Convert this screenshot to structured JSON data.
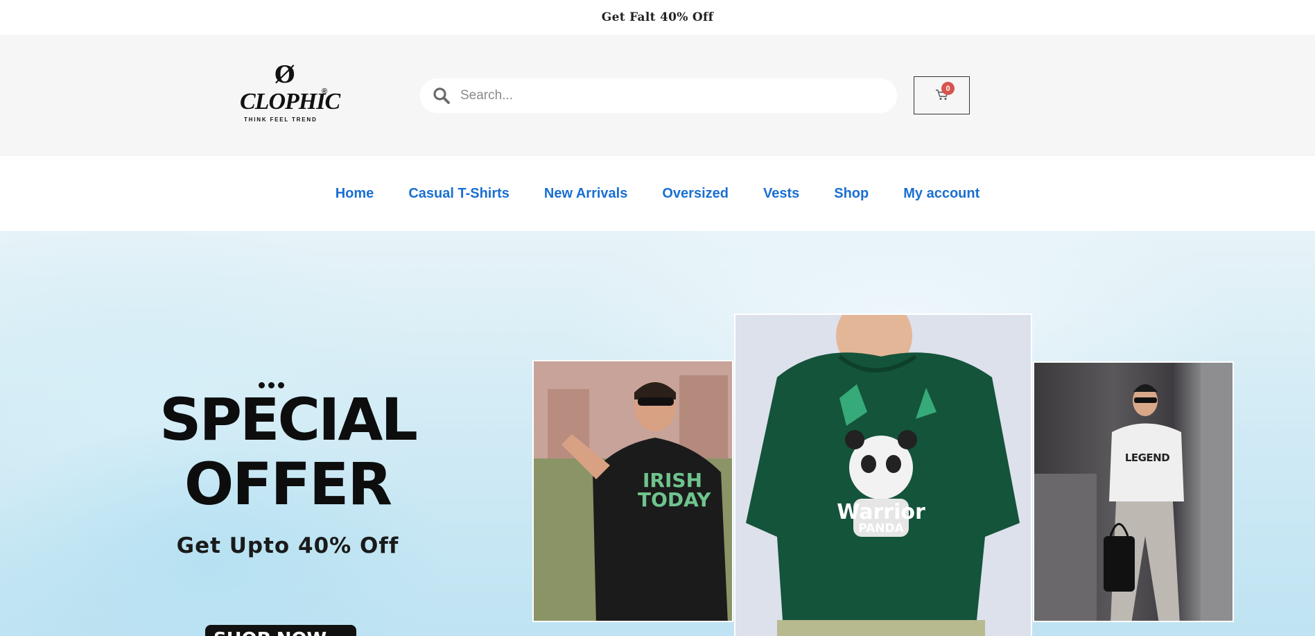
{
  "announcement": {
    "text": "Get Falt 40% Off"
  },
  "header": {
    "logo": {
      "mark": "Ø",
      "brand": "CLOPHIC",
      "registered": "®",
      "tagline": "THINK FEEL TREND"
    },
    "search": {
      "placeholder": "Search...",
      "value": "",
      "icon": "search-icon"
    },
    "cart": {
      "count": "0",
      "icon": "cart-icon"
    }
  },
  "nav": {
    "items": [
      {
        "label": "Home"
      },
      {
        "label": "Casual T-Shirts"
      },
      {
        "label": "New Arrivals"
      },
      {
        "label": "Oversized"
      },
      {
        "label": "Vests"
      },
      {
        "label": "Shop"
      },
      {
        "label": "My account"
      }
    ]
  },
  "hero": {
    "headline_1": "SPECIAL",
    "headline_2": "OFFER",
    "subline": "Get Upto 40% Off",
    "cta": "SHOP NOW",
    "photos": [
      {
        "shirt_line_1": "IRISH",
        "shirt_line_2": "TODAY"
      },
      {
        "shirt_line_1": "Warrior",
        "shirt_line_2": "PANDA"
      },
      {
        "shirt_line_1": "LEGEND"
      }
    ]
  },
  "colors": {
    "nav_link": "#1a6fd1",
    "cart_badge": "#d9534f",
    "header_bg": "#f6f6f6"
  }
}
